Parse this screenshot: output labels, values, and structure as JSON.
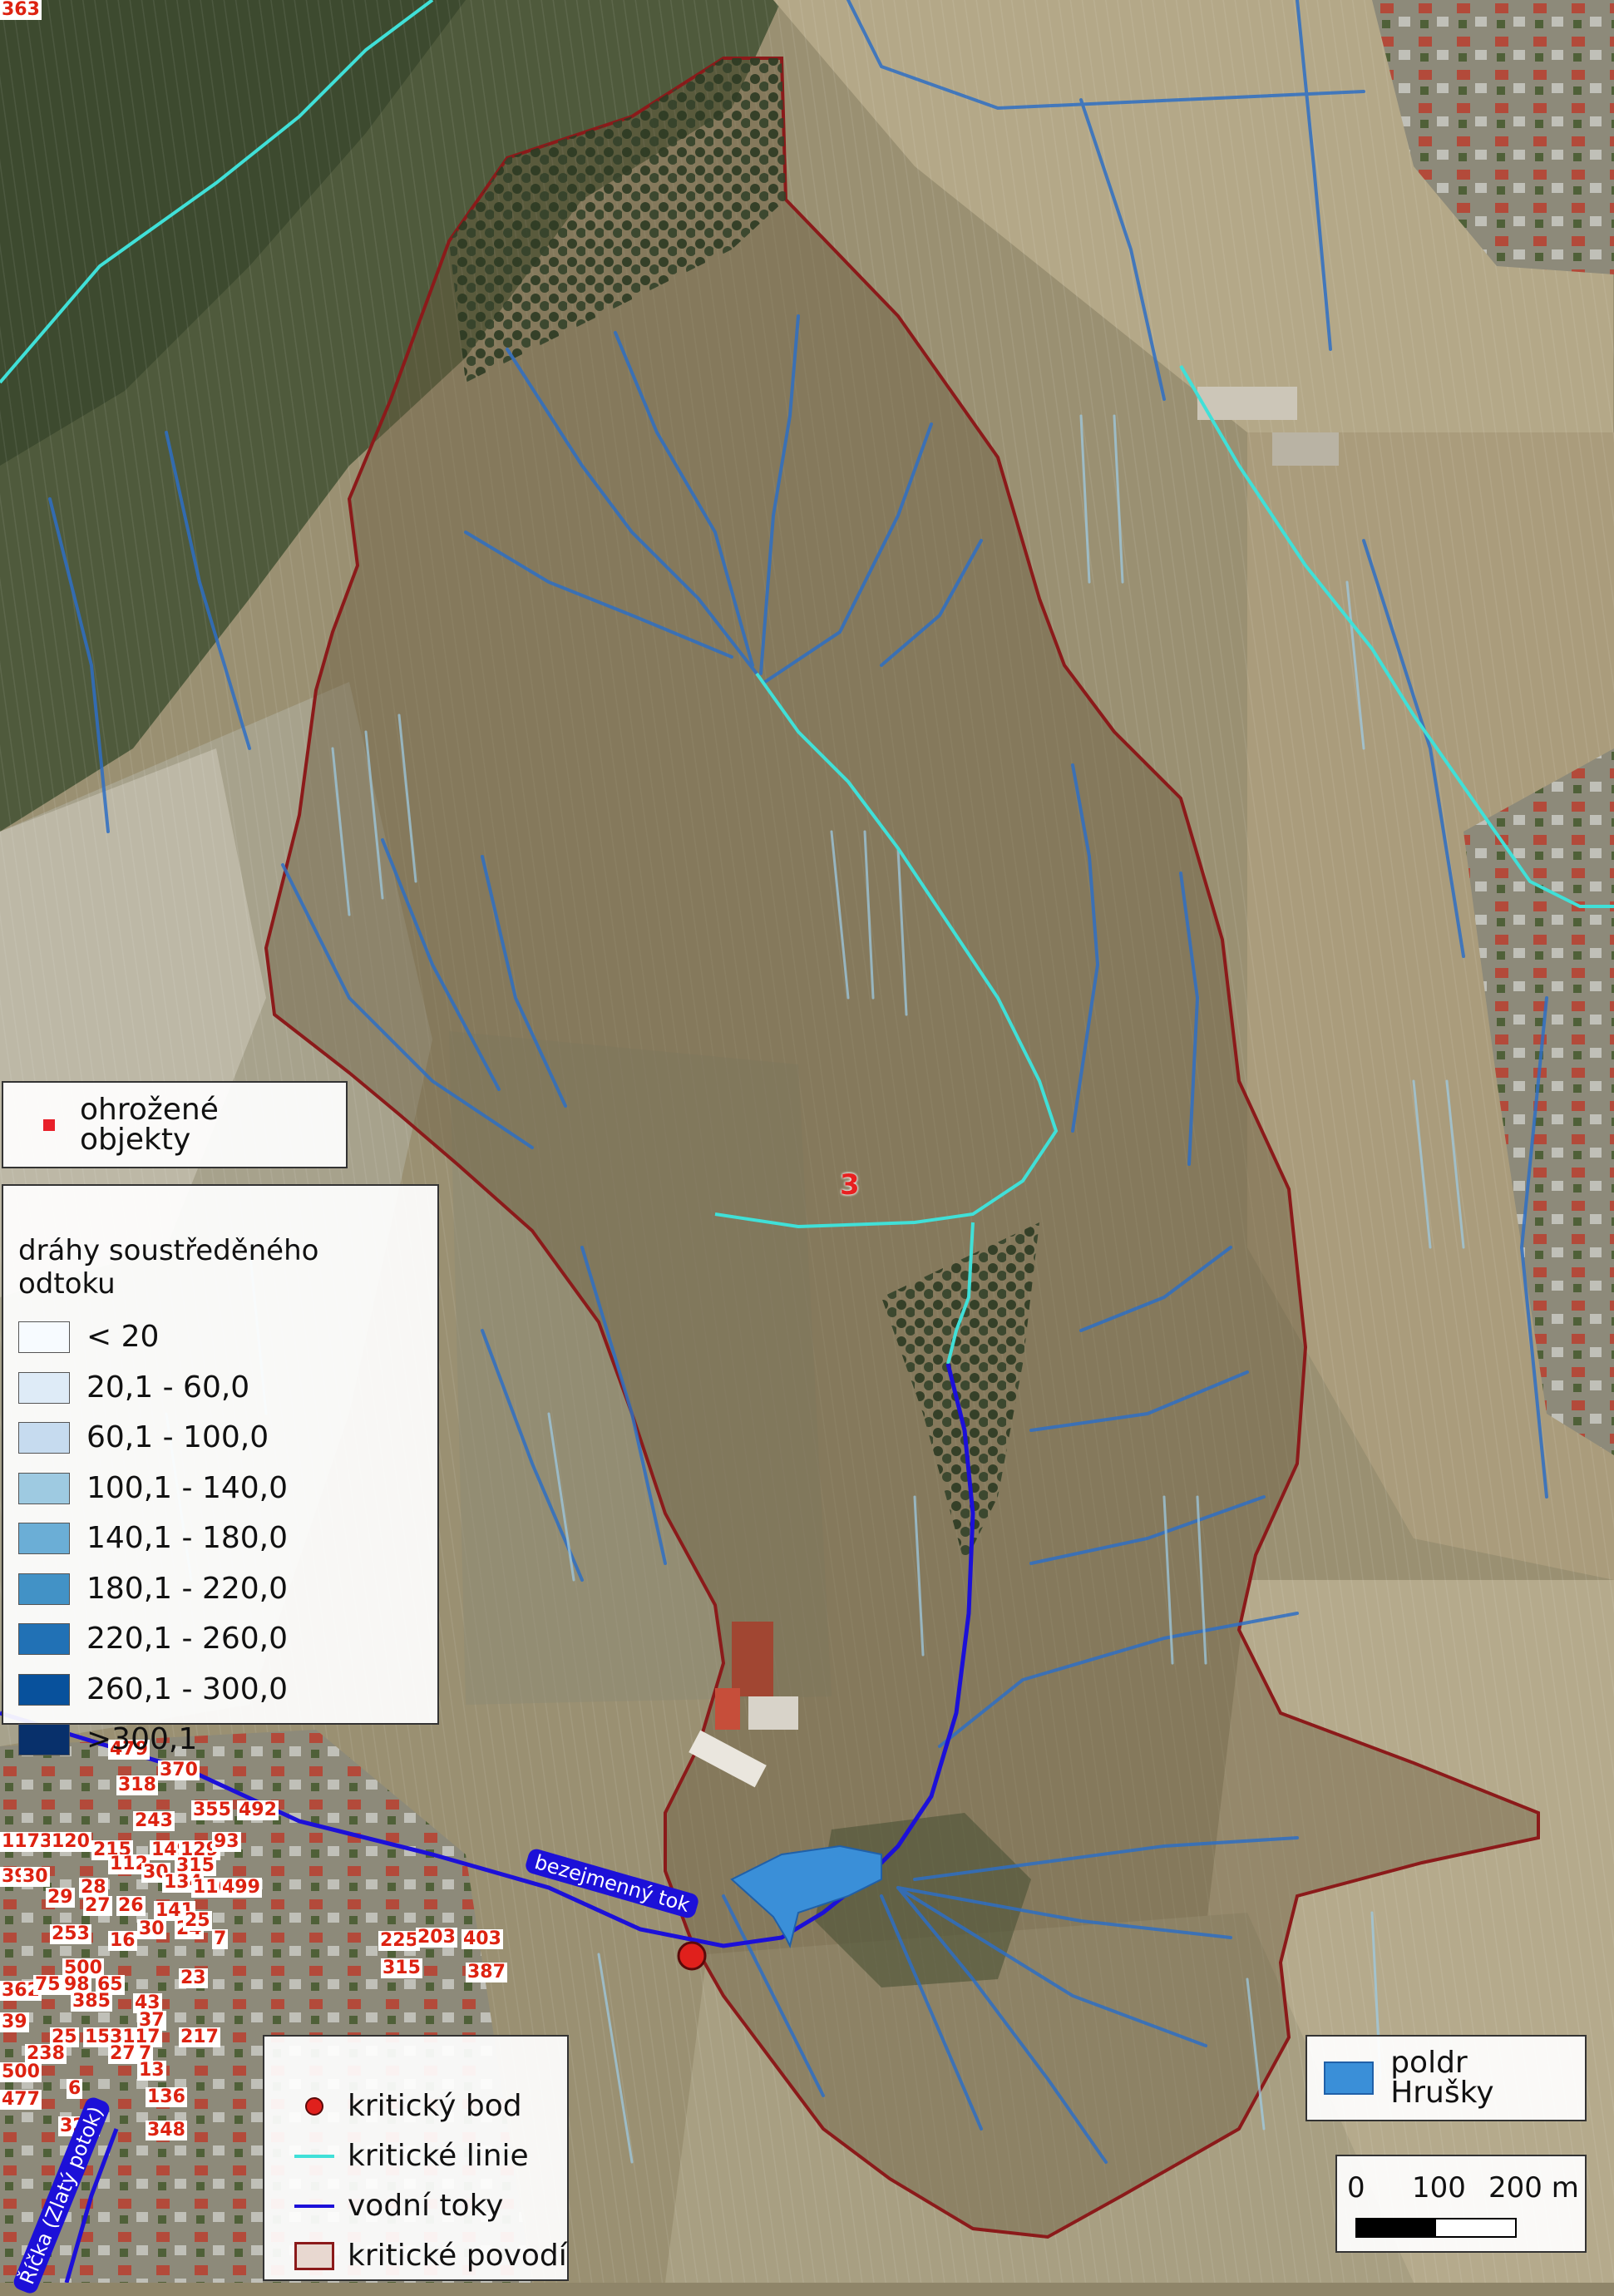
{
  "basin_number": "3",
  "labels": {
    "stream_name": "bezejmenný tok",
    "river_name": "Říčka (Zlatý potok)"
  },
  "legend_threatened": {
    "label": "ohrožené objekty",
    "color": "#e8202a"
  },
  "legend_flow": {
    "title": "dráhy soustředěného odtoku",
    "classes": [
      {
        "label": "< 20",
        "color": "#f7fbff"
      },
      {
        "label": "20,1 - 60,0",
        "color": "#deebf7"
      },
      {
        "label": "60,1 - 100,0",
        "color": "#c6dbef"
      },
      {
        "label": "100,1 - 140,0",
        "color": "#9ecae1"
      },
      {
        "label": "140,1 - 180,0",
        "color": "#6baed6"
      },
      {
        "label": "180,1 - 220,0",
        "color": "#4292c6"
      },
      {
        "label": "220,1 - 260,0",
        "color": "#2171b5"
      },
      {
        "label": "260,1 - 300,0",
        "color": "#08519c"
      },
      {
        "label": ">300,1",
        "color": "#08306b"
      }
    ]
  },
  "legend_bottom": {
    "items": [
      {
        "label": "kritický bod",
        "symbol": "point",
        "color": "#e0201c"
      },
      {
        "label": "kritické linie",
        "symbol": "line",
        "color": "#40e0d8"
      },
      {
        "label": "vodní toky",
        "symbol": "line",
        "color": "#1c10d8"
      },
      {
        "label": "kritické povodí",
        "symbol": "polygon",
        "color": "#8b1a1a"
      }
    ]
  },
  "legend_polder": {
    "label": "poldr Hrušky",
    "color": "#3a8fd8"
  },
  "scale_bar": {
    "ticks": [
      "0",
      "100",
      "200 m"
    ]
  },
  "threatened_objects": [
    "479",
    "370",
    "318",
    "243",
    "355",
    "492",
    "1173",
    "120",
    "215",
    "149",
    "129",
    "93",
    "112",
    "30",
    "315",
    "39",
    "30",
    "29",
    "28",
    "134",
    "110",
    "499",
    "27",
    "26",
    "141",
    "30",
    "24",
    "25",
    "253",
    "16",
    "7",
    "500",
    "225",
    "203",
    "403",
    "315",
    "387",
    "362",
    "75",
    "98",
    "65",
    "23",
    "385",
    "43",
    "37",
    "39",
    "217",
    "17",
    "25",
    "15",
    "31",
    "238",
    "27",
    "7",
    "500",
    "13",
    "6",
    "477",
    "136",
    "328",
    "348",
    "363"
  ]
}
